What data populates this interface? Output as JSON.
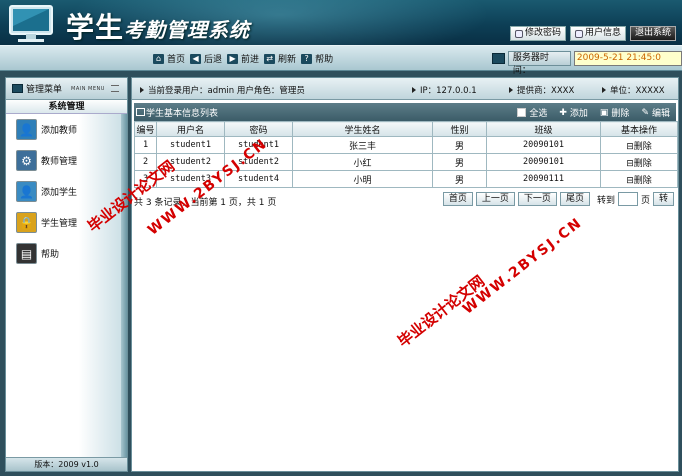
{
  "header": {
    "title_big": "学生",
    "title_rest": "考勤管理系统",
    "buttons": {
      "change_pwd": "修改密码",
      "user_info": "用户信息",
      "logout": "退出系统"
    }
  },
  "nav": {
    "home": "首页",
    "back": "后退",
    "forward": "前进",
    "refresh": "刷新",
    "help": "帮助",
    "server_label": "服务器时间：",
    "server_time": "2009-5-21 21:45:0"
  },
  "sidebar": {
    "title": "管理菜单",
    "title_en": "MAIN MENU",
    "section": "系统管理",
    "items": [
      {
        "label": "添加教师",
        "icon": "add-teacher-icon"
      },
      {
        "label": "教师管理",
        "icon": "gear-icon"
      },
      {
        "label": "添加学生",
        "icon": "add-student-icon"
      },
      {
        "label": "学生管理",
        "icon": "lock-icon"
      },
      {
        "label": "帮助",
        "icon": "help-book-icon"
      }
    ],
    "footer": "版本：2009 v1.0"
  },
  "infobar": {
    "current_user": "当前登录用户：admin  用户角色：管理员",
    "ip": "IP：127.0.0.1",
    "provider": "提供商：XXXX",
    "unit": "单位：XXXXX"
  },
  "table": {
    "title": "学生基本信息列表",
    "actions": {
      "select_all": "全选",
      "add": "添加",
      "delete": "删除",
      "edit": "编辑"
    },
    "headers": [
      "编号",
      "用户名",
      "密码",
      "学生姓名",
      "性别",
      "班级",
      "基本操作"
    ],
    "rows": [
      [
        "1",
        "student1",
        "student1",
        "张三丰",
        "男",
        "20090101",
        "删除"
      ],
      [
        "2",
        "student2",
        "student2",
        "小红",
        "男",
        "20090101",
        "删除"
      ],
      [
        "3",
        "student3",
        "student4",
        "小明",
        "男",
        "20090111",
        "删除"
      ]
    ]
  },
  "pager": {
    "info": "共 3 条记录，当前第 1 页，共 1 页",
    "first": "首页",
    "prev": "上一页",
    "next": "下一页",
    "last": "尾页",
    "goto": "转到",
    "page": "页",
    "go": "转"
  },
  "watermarks": {
    "cn": "毕业设计论文网",
    "url": "WWW.2BYSJ.CN"
  },
  "colors": {
    "watermark": "#d40000",
    "header_bg": "#0d3f56",
    "time_text": "#cc6600"
  }
}
